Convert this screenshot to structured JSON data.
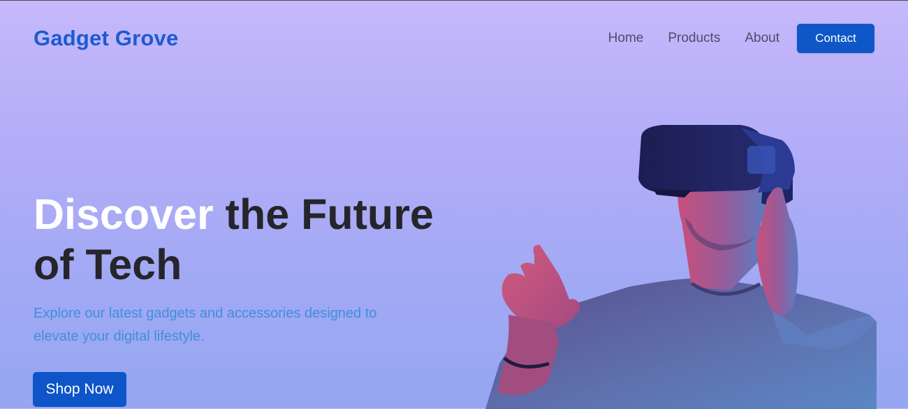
{
  "nav": {
    "brand": "Gadget Grove",
    "links": [
      "Home",
      "Products",
      "About"
    ],
    "cta": "Contact"
  },
  "hero": {
    "title_highlight": "Discover",
    "title_rest": " the Future of Tech",
    "subtitle": "Explore our latest gadgets and accessories designed to elevate your digital lifestyle.",
    "button": "Shop Now",
    "image": "man-with-vr-headset-pointing"
  },
  "colors": {
    "brand": "#1b5bd0",
    "button": "#0f57c9",
    "bg_top": "#c6b8fb",
    "bg_bottom": "#95a6f1",
    "subtitle": "#3f8fdc"
  }
}
